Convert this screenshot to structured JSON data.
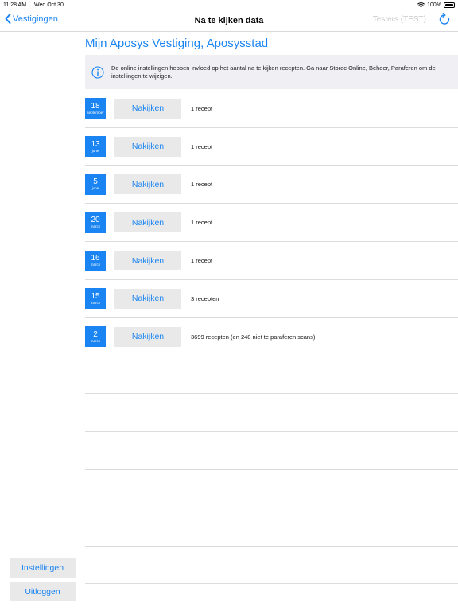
{
  "status_bar": {
    "time": "11:28 AM",
    "date": "Wed Oct 30",
    "battery": "100%",
    "battery_level": 1.0
  },
  "nav": {
    "back_label": "Vestigingen",
    "title": "Na te kijken data",
    "right_label": "Testers (TEST)"
  },
  "branch_title": "Mijn Aposys Vestiging, Aposysstad",
  "info_text": "De online instellingen hebben invloed op het aantal na te kijken recepten. Ga naar Storec Online, Beheer, Paraferen om de instellingen te wijzigen.",
  "rows": [
    {
      "day": "18",
      "month": "september",
      "button": "Nakijken",
      "count": "1 recept"
    },
    {
      "day": "13",
      "month": "june",
      "button": "Nakijken",
      "count": "1 recept"
    },
    {
      "day": "5",
      "month": "june",
      "button": "Nakijken",
      "count": "1 recept"
    },
    {
      "day": "20",
      "month": "march",
      "button": "Nakijken",
      "count": "1 recept"
    },
    {
      "day": "16",
      "month": "march",
      "button": "Nakijken",
      "count": "1 recept"
    },
    {
      "day": "15",
      "month": "march",
      "button": "Nakijken",
      "count": "3 recepten"
    },
    {
      "day": "2",
      "month": "march",
      "button": "Nakijken",
      "count": "3699 recepten (en 248 niet te paraferen scans)"
    }
  ],
  "empty_rows": 6,
  "sidebar": {
    "settings_label": "Instellingen",
    "logout_label": "Uitloggen"
  },
  "colors": {
    "accent": "#1a84f2",
    "info_bg": "#efeff4",
    "button_bg": "#e9e9e9"
  }
}
